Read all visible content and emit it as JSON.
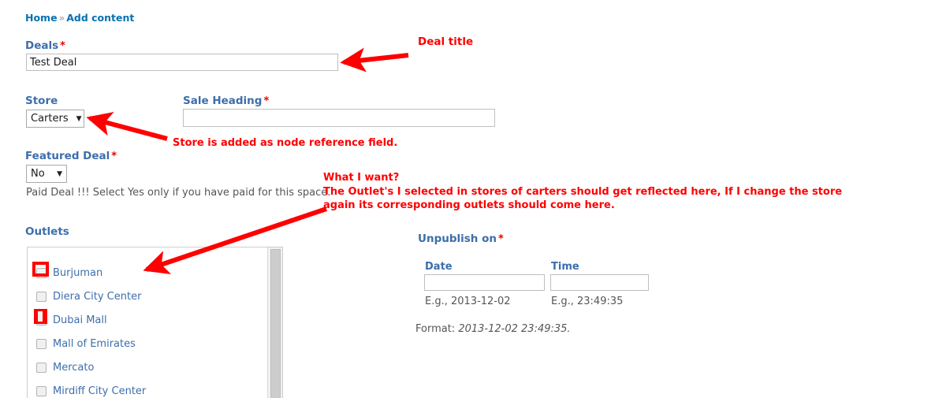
{
  "breadcrumb": {
    "home": "Home",
    "separator": "»",
    "current": "Add content"
  },
  "form": {
    "deals": {
      "label": "Deals",
      "required_mark": "*",
      "value": "Test Deal"
    },
    "store": {
      "label": "Store",
      "selected": "Carters"
    },
    "sale_heading": {
      "label": "Sale Heading",
      "required_mark": "*",
      "value": ""
    },
    "featured_deal": {
      "label": "Featured Deal",
      "required_mark": "*",
      "selected": "No",
      "description": "Paid Deal !!! Select Yes only if you have paid for this space."
    },
    "outlets": {
      "label": "Outlets",
      "items": [
        {
          "label": "Burjuman",
          "checked": false
        },
        {
          "label": "Diera City Center",
          "checked": false
        },
        {
          "label": "Dubai Mall",
          "checked": false
        },
        {
          "label": "Mall of Emirates",
          "checked": false
        },
        {
          "label": "Mercato",
          "checked": false
        },
        {
          "label": "Mirdiff City Center",
          "checked": false
        }
      ]
    },
    "unpublish_on": {
      "label": "Unpublish on",
      "required_mark": "*",
      "date": {
        "label": "Date",
        "value": "",
        "hint": "E.g., 2013-12-02"
      },
      "time": {
        "label": "Time",
        "value": "",
        "hint": "E.g., 23:49:35"
      },
      "format_label": "Format:",
      "format_value": "2013-12-02 23:49:35."
    }
  },
  "annotations": {
    "deal_title": "Deal title",
    "store_note": "Store is added as node reference field.",
    "what_i_want_heading": "What I want?",
    "what_i_want_body": "The Outlet's I selected in stores of carters should get reflected here, If I change the store again its corresponding outlets should come here."
  },
  "colors": {
    "label_blue": "#3d6eab",
    "link_blue": "#0971b2",
    "annotation_red": "#ff0000",
    "required_red": "#e60000",
    "description_gray": "#555555"
  }
}
